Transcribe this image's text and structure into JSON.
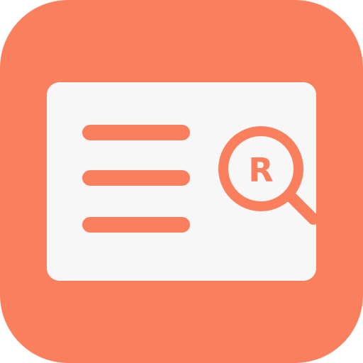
{
  "icon": {
    "name": "trademark-search-app-icon",
    "symbol": "R",
    "colors": {
      "background": "#fa7f5d",
      "card": "#f7f7f7",
      "accent": "#fa7f5d"
    },
    "glyphs": [
      "document-lines-icon",
      "magnifier-icon",
      "registered-mark-icon"
    ]
  }
}
